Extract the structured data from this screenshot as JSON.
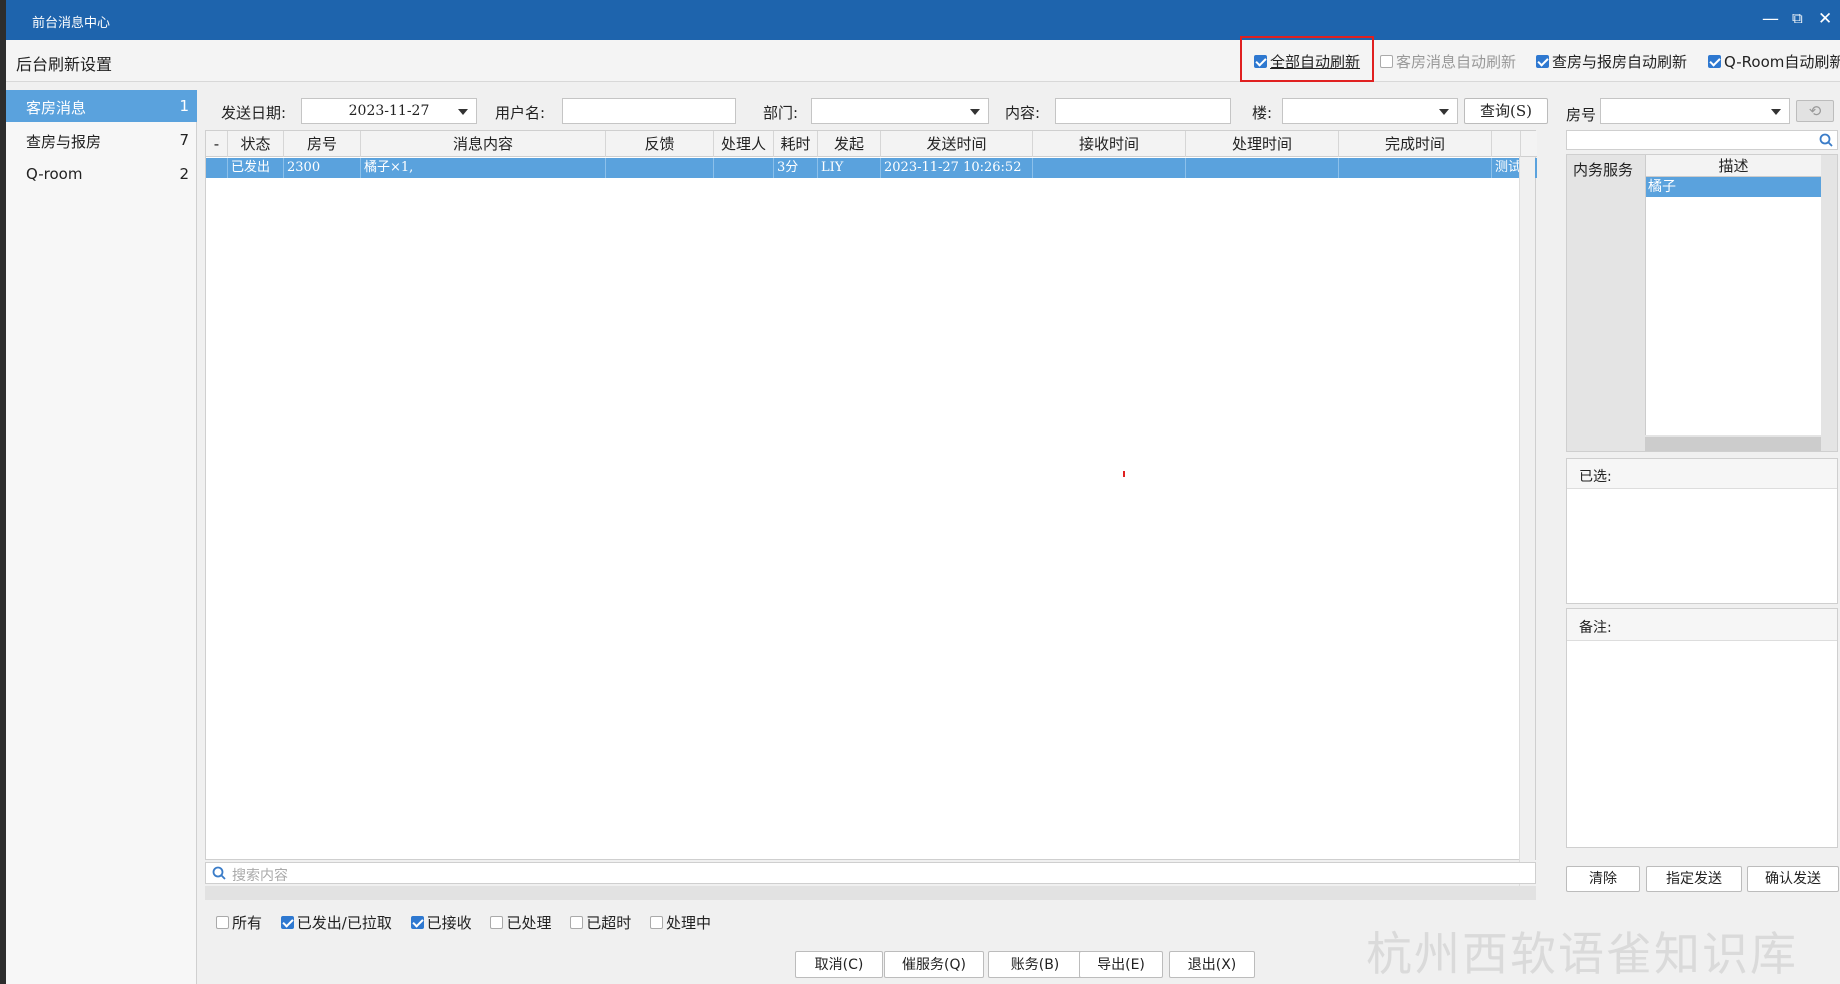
{
  "window": {
    "title": "前台消息中心",
    "minimize": "—",
    "restore": "⧉",
    "close": "✕"
  },
  "settings": {
    "label": "后台刷新设置",
    "options": [
      {
        "label": "全部自动刷新",
        "checked": true,
        "enabled": true
      },
      {
        "label": "客房消息自动刷新",
        "checked": false,
        "enabled": false
      },
      {
        "label": "查房与报房自动刷新",
        "checked": true,
        "enabled": true
      },
      {
        "label": "Q-Room自动刷新",
        "checked": true,
        "enabled": true
      }
    ]
  },
  "sidebar": {
    "items": [
      {
        "label": "客房消息",
        "count": "1",
        "active": true
      },
      {
        "label": "查房与报房",
        "count": "7",
        "active": false
      },
      {
        "label": "Q-room",
        "count": "2",
        "active": false
      }
    ]
  },
  "filters": {
    "date_label": "发送日期:",
    "date_value": "2023-11-27",
    "user_label": "用户名:",
    "user_value": "",
    "dept_label": "部门:",
    "dept_value": "",
    "content_label": "内容:",
    "content_value": "",
    "building_label": "楼:",
    "building_value": "",
    "query_button": "查询(S)",
    "room_label": "房号",
    "room_value": ""
  },
  "table": {
    "columns": [
      "-",
      "状态",
      "房号",
      "消息内容",
      "反馈",
      "处理人",
      "耗时",
      "发起",
      "发送时间",
      "接收时间",
      "处理时间",
      "完成时间",
      ""
    ],
    "rows": [
      {
        "status": "已发出",
        "room": "2300",
        "content": "橘子×1,",
        "feedback": "",
        "handler": "",
        "duration": "3分",
        "initiator": "LIY",
        "sent": "2023-11-27 10:26:52",
        "received": "",
        "processed": "",
        "completed": "",
        "extra": "测试"
      }
    ],
    "search_placeholder": "搜索内容"
  },
  "status_filters": [
    {
      "label": "所有",
      "checked": false
    },
    {
      "label": "已发出/已拉取",
      "checked": true
    },
    {
      "label": "已接收",
      "checked": true
    },
    {
      "label": "已处理",
      "checked": false
    },
    {
      "label": "已超时",
      "checked": false
    },
    {
      "label": "处理中",
      "checked": false
    }
  ],
  "bottom_buttons": [
    "取消(C)",
    "催服务(Q)",
    "账务(B)",
    "导出(E)",
    "退出(X)"
  ],
  "service_panel": {
    "col_category": "内务服务",
    "col_desc": "描述",
    "items": [
      "橘子"
    ],
    "selected_label": "已选:",
    "remark_label": "备注:",
    "buttons": [
      "清除",
      "指定发送",
      "确认发送"
    ]
  },
  "watermark": "杭州西软语雀知识库",
  "colors": {
    "titlebar": "#1e64ad",
    "selection": "#5aa2dd",
    "highlight": "#e02020"
  }
}
